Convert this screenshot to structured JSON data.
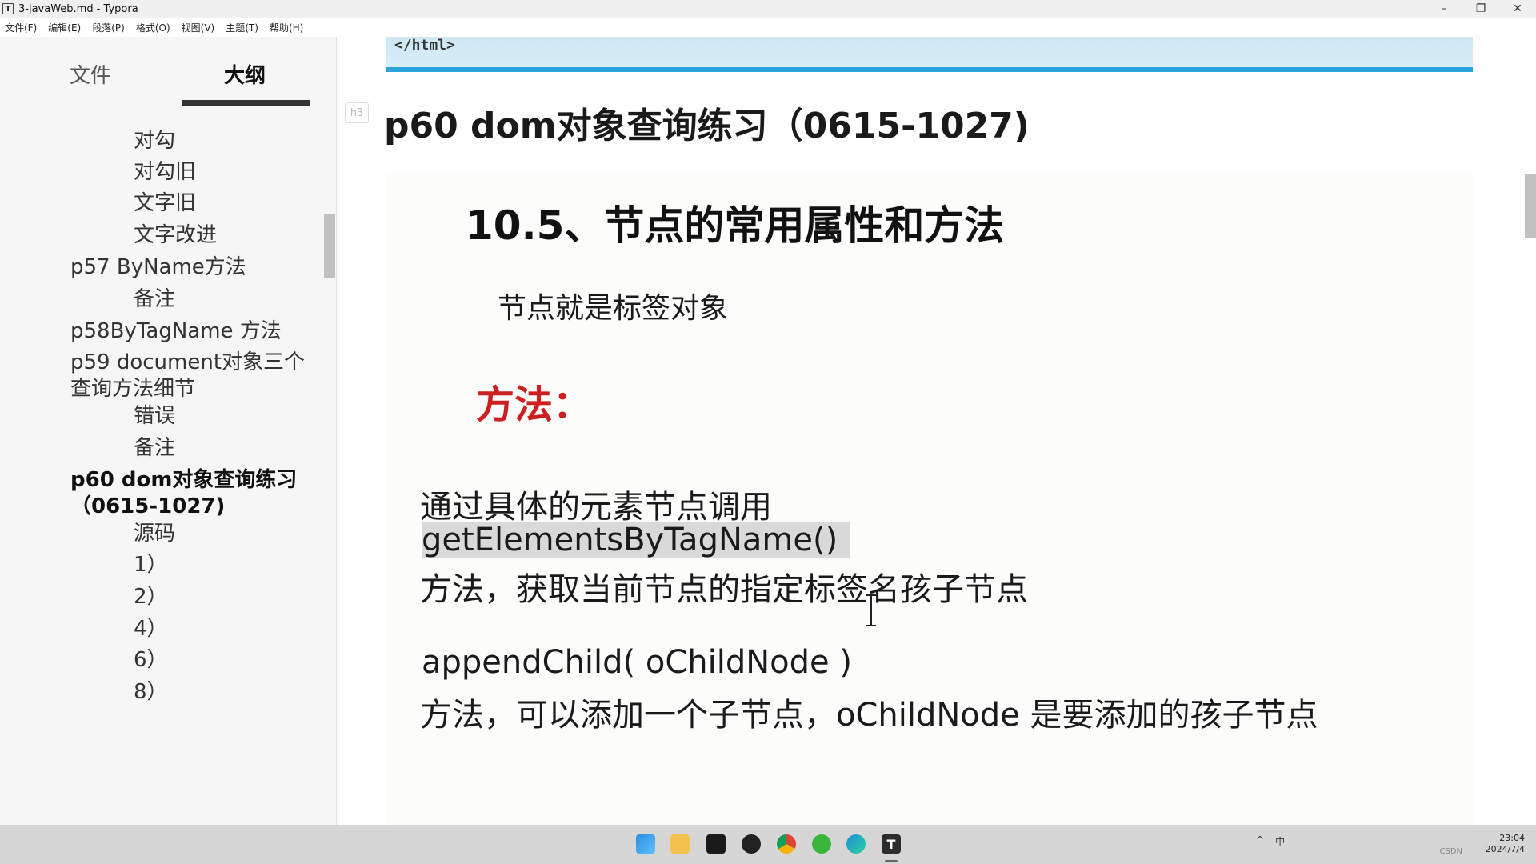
{
  "window": {
    "title": "3-javaWeb.md - Typora",
    "app_icon": "T",
    "controls": [
      "–",
      "❐",
      "✕"
    ]
  },
  "menubar": [
    "文件(F)",
    "编辑(E)",
    "段落(P)",
    "格式(O)",
    "视图(V)",
    "主题(T)",
    "帮助(H)"
  ],
  "sidebar": {
    "tabs": [
      "文件",
      "大纲"
    ],
    "active_tab": "大纲",
    "outline": [
      {
        "label": "对勾",
        "level": 2
      },
      {
        "label": "对勾旧",
        "level": 2
      },
      {
        "label": "文字旧",
        "level": 2
      },
      {
        "label": "文字改进",
        "level": 2
      },
      {
        "label": "p57 ByName方法",
        "level": 1
      },
      {
        "label": "备注",
        "level": 2
      },
      {
        "label": "p58ByTagName 方法",
        "level": 1
      },
      {
        "label": "p59 document对象三个查询方法细节",
        "level": 1
      },
      {
        "label": "错误",
        "level": 2
      },
      {
        "label": "备注",
        "level": 2
      },
      {
        "label": "p60 dom对象查询练习（0615-1027)",
        "level": 1,
        "active": true
      },
      {
        "label": "源码",
        "level": 2
      },
      {
        "label": "1）",
        "level": 2
      },
      {
        "label": "2）",
        "level": 2
      },
      {
        "label": "4）",
        "level": 2
      },
      {
        "label": "6）",
        "level": 2
      },
      {
        "label": "8）",
        "level": 2
      }
    ]
  },
  "editor": {
    "code_tail": "</html>",
    "heading_tag": "h3",
    "heading": "p60 dom对象查询练习（0615-1027)",
    "slide": {
      "title": "10.5、节点的常用属性和方法",
      "subtitle": "节点就是标签对象",
      "method_label": "方法：",
      "line1": "通过具体的元素节点调用",
      "line2": "getElementsByTagName()",
      "line3": "方法，获取当前节点的指定标签名孩子节点",
      "line4": "appendChild( oChildNode )",
      "line5": "方法，可以添加一个子节点，oChildNode 是要添加的孩子节点"
    }
  },
  "taskbar": {
    "icons": [
      "windows-start-icon",
      "file-explorer-icon",
      "intellij-icon",
      "qq-icon",
      "chrome-icon",
      "wechat-icon",
      "edge-icon",
      "typora-icon"
    ],
    "typora_letter": "T",
    "tray": [
      "^",
      "中"
    ],
    "time": "23:04",
    "date": "2024/7/4",
    "watermark": "CSDN"
  }
}
